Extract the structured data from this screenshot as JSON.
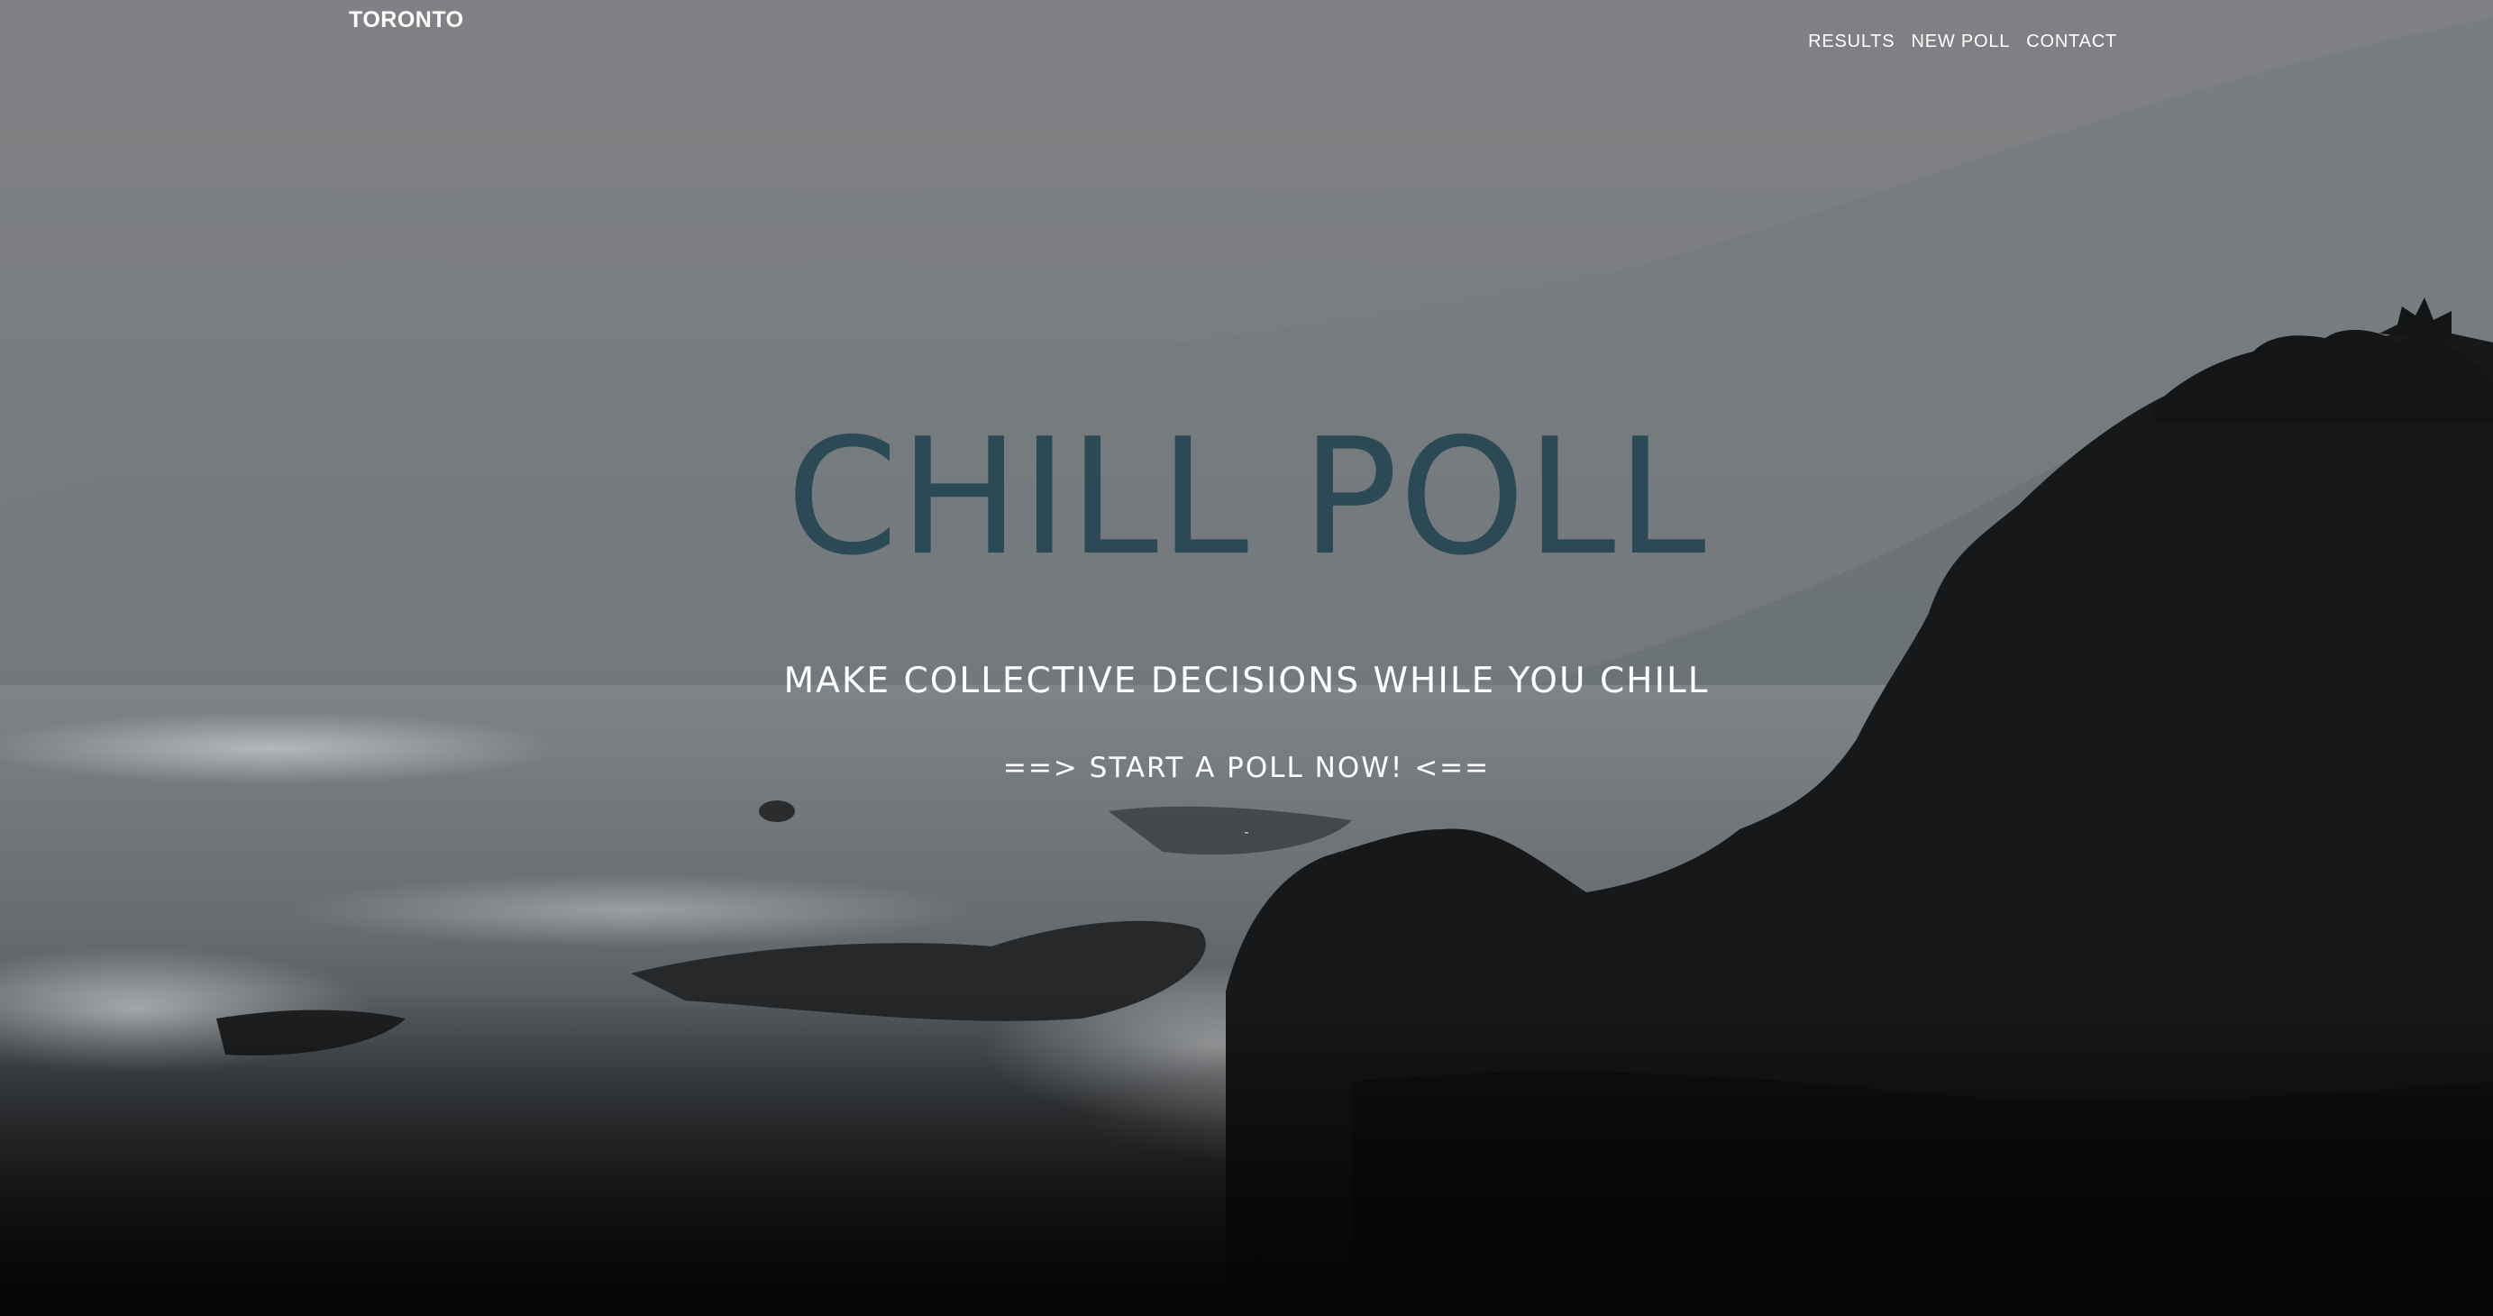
{
  "header": {
    "brand": "TORONTO",
    "nav": [
      {
        "label": "RESULTS"
      },
      {
        "label": "NEW POLL"
      },
      {
        "label": "CONTACT"
      }
    ]
  },
  "hero": {
    "title": "CHILL POLL",
    "tagline": "MAKE COLLECTIVE DECISIONS WHILE YOU CHILL",
    "cta": "==> START A POLL NOW! <==",
    "dash": "-"
  },
  "colors": {
    "title": "#2b4a55",
    "text": "#ffffff",
    "sky": "#808184",
    "rock": "#141415"
  }
}
